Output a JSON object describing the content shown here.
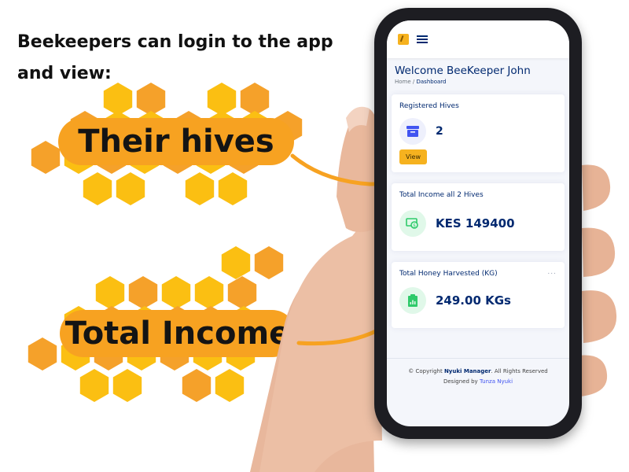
{
  "intro": {
    "line1": "Beekeepers can login to the app",
    "line2": "and view:"
  },
  "callouts": {
    "hives": "Their hives",
    "income": "Total Income"
  },
  "app": {
    "welcome": "Welcome BeeKeeper John",
    "breadcrumb": {
      "home": "Home",
      "separator": "/",
      "current": "Dashboard"
    },
    "cards": {
      "hives": {
        "title": "Registered Hives",
        "value": "2",
        "button": "View"
      },
      "income": {
        "title": "Total Income all 2 Hives",
        "value": "KES 149400"
      },
      "honey": {
        "title": "Total Honey Harvested (KG)",
        "value": "249.00 KGs",
        "menu": "..."
      }
    },
    "footer": {
      "copyright_prefix": "© Copyright",
      "brand": "Nyuki Manager",
      "rights": ". All Rights Reserved",
      "designed_by": "Designed by",
      "designer": "Tunza Nyuki"
    }
  },
  "colors": {
    "accent_orange": "#f7a221",
    "honey_yellow": "#fbbf12",
    "hex_orange": "#f5a12a",
    "navy": "#012970"
  },
  "icons": [
    "logo-icon",
    "menu-icon",
    "archive-icon",
    "cash-icon",
    "clipboard-chart-icon",
    "more-icon",
    "arrow-icon"
  ]
}
